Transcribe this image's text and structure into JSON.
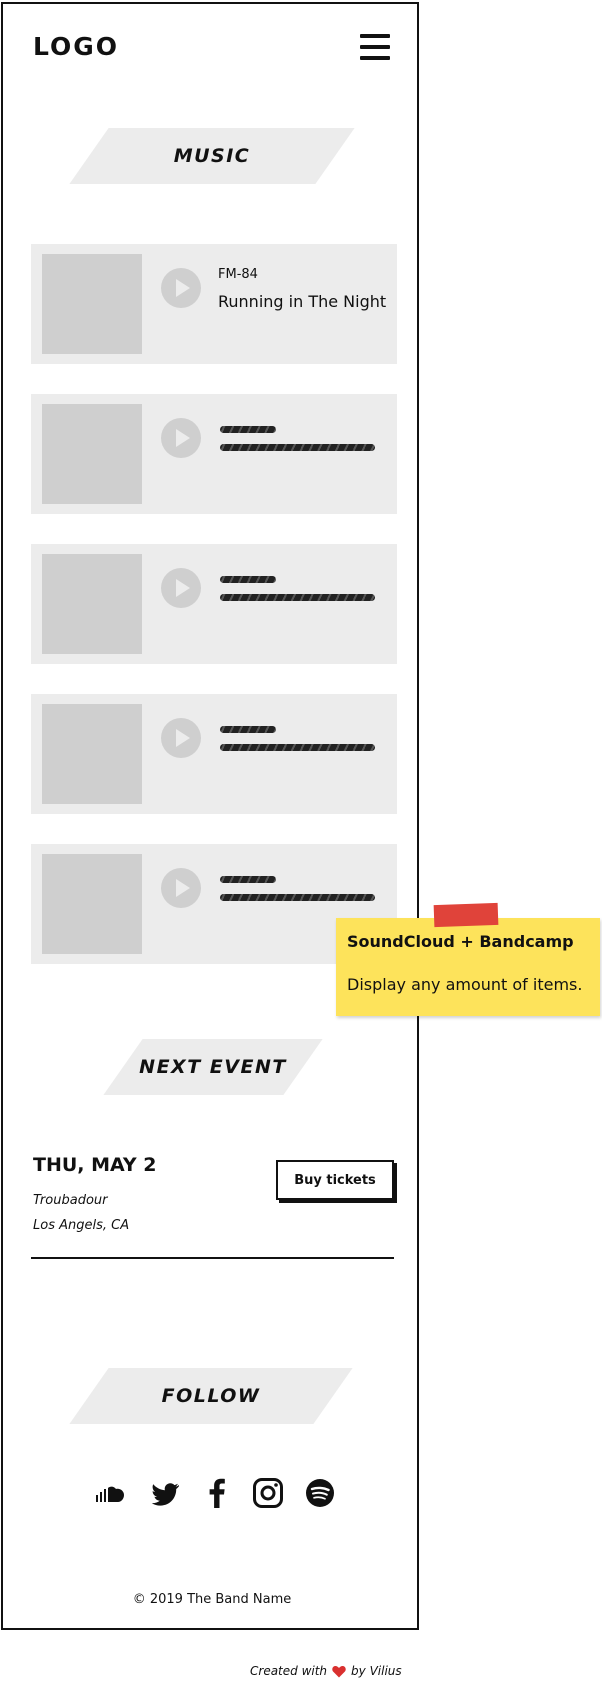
{
  "header": {
    "logo": "LOGO",
    "menu_icon": "hamburger-menu-icon"
  },
  "music": {
    "title": "MUSIC",
    "tracks": [
      {
        "artist": "FM-84",
        "song": "Running in The Night"
      },
      {
        "artist": "",
        "song": ""
      },
      {
        "artist": "",
        "song": ""
      },
      {
        "artist": "",
        "song": ""
      },
      {
        "artist": "",
        "song": ""
      }
    ]
  },
  "sticky_note": {
    "title": "SoundCloud + Bandcamp",
    "body": "Display any amount of items."
  },
  "next_event": {
    "title": "NEXT EVENT",
    "date": "THU, MAY 2",
    "venue": "Troubadour",
    "location": "Los Angels, CA",
    "button_label": "Buy tickets"
  },
  "follow": {
    "title": "FOLLOW",
    "icons": [
      "soundcloud-icon",
      "twitter-icon",
      "facebook-icon",
      "instagram-icon",
      "spotify-icon"
    ]
  },
  "footer": {
    "copyright": "© 2019 The Band Name"
  },
  "credit": {
    "prefix": "Created with",
    "suffix": "by Vilius"
  },
  "colors": {
    "panel_bg": "#ececec",
    "placeholder": "#cfcfcf",
    "sticky_bg": "#fde35b",
    "tape": "#e0433a",
    "heart": "#d9302f"
  }
}
